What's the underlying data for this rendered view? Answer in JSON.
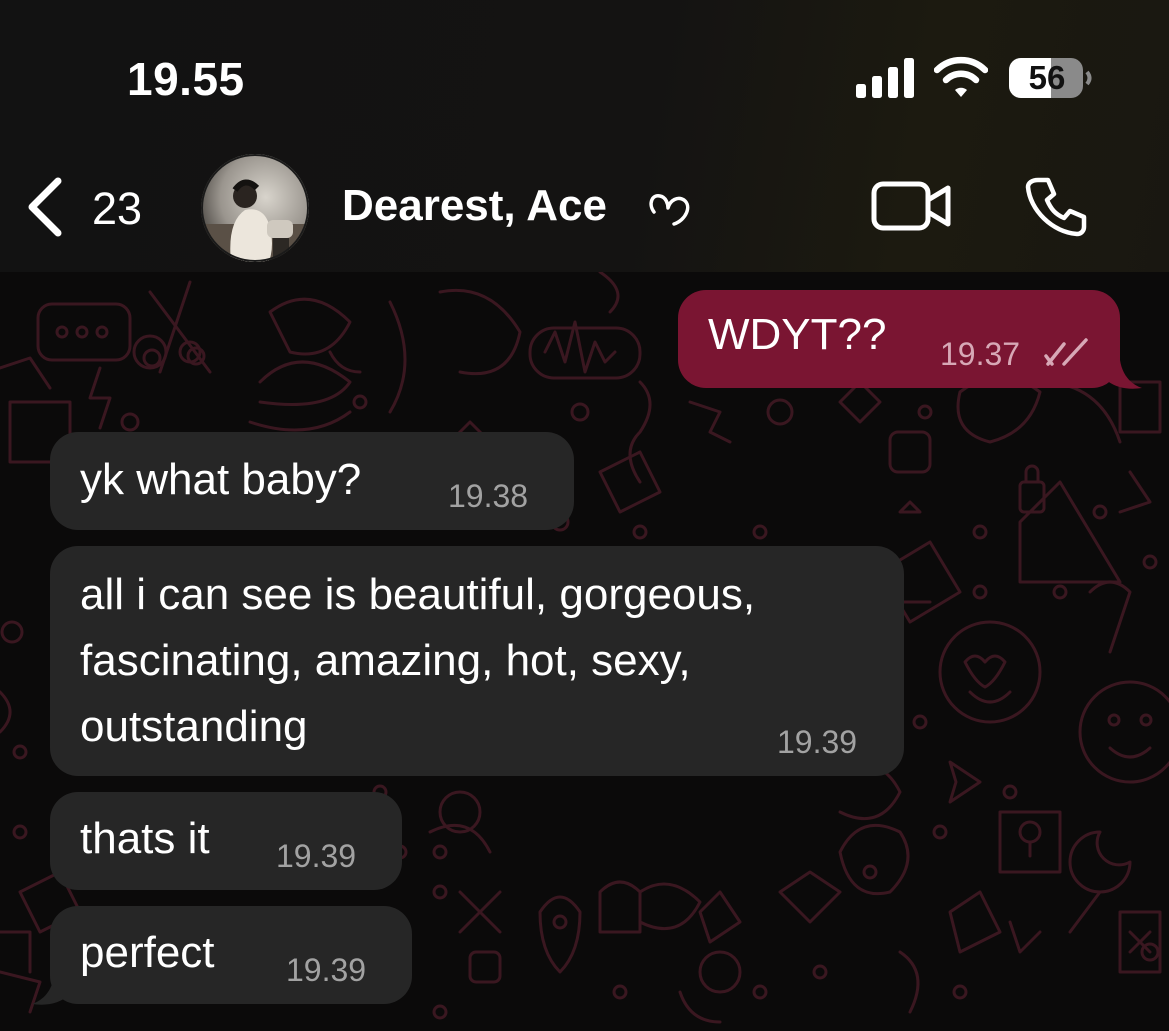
{
  "status_bar": {
    "time": "19.55",
    "battery": "56",
    "signal_icon": "cellular-signal-icon",
    "wifi_icon": "wifi-icon",
    "battery_icon": "battery-icon"
  },
  "header": {
    "back_icon": "chevron-left-icon",
    "back_count": "23",
    "contact_name": "Dearest, Ace",
    "name_emoji_icon": "heart-outline-icon",
    "video_icon": "video-camera-icon",
    "call_icon": "phone-icon"
  },
  "messages": [
    {
      "direction": "outgoing",
      "text": "WDYT??",
      "time": "19.37",
      "status_icon": "double-check-icon"
    },
    {
      "direction": "incoming",
      "text": "yk what baby?",
      "time": "19.38"
    },
    {
      "direction": "incoming",
      "lines": [
        "all i can see is beautiful, gorgeous,",
        "fascinating, amazing, hot, sexy,",
        "outstanding"
      ],
      "time": "19.39"
    },
    {
      "direction": "incoming",
      "text": "thats it",
      "time": "19.39"
    },
    {
      "direction": "incoming",
      "text": "perfect",
      "time": "19.39"
    }
  ],
  "colors": {
    "background": "#0b0a0a",
    "incoming_bubble": "#262626",
    "outgoing_bubble": "#7a1532",
    "doodle": "#3a1720",
    "timestamp": "#a2a2a2"
  }
}
